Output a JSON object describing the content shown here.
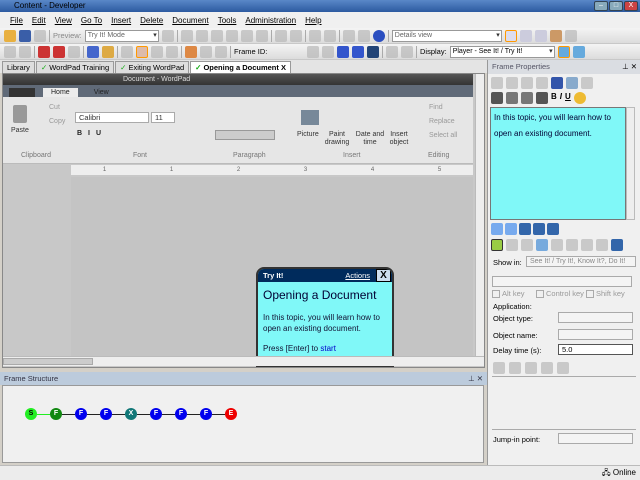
{
  "window": {
    "title": "Content - Developer",
    "min": "–",
    "max": "□",
    "close": "X"
  },
  "menu": [
    "File",
    "Edit",
    "View",
    "Go To",
    "Insert",
    "Delete",
    "Document",
    "Tools",
    "Administration",
    "Help"
  ],
  "toolbar1": {
    "preview_label": "Preview:",
    "preview_mode": "Try It! Mode",
    "view_select": "Details view"
  },
  "toolbar2": {
    "frame_id_label": "Frame ID:",
    "display_label": "Display:",
    "display_select": "Player - See It! / Try It!"
  },
  "tabs": [
    {
      "label": "Library"
    },
    {
      "label": "WordPad Training"
    },
    {
      "label": "Exiting WordPad"
    },
    {
      "label": "Opening a Document",
      "close": "X"
    }
  ],
  "wordpad": {
    "title": "Document - WordPad",
    "tabs": [
      "Home",
      "View"
    ],
    "clipboard": {
      "paste": "Paste",
      "cut": "Cut",
      "copy": "Copy",
      "group": "Clipboard"
    },
    "font": {
      "name": "Calibri",
      "size": "11",
      "group": "Font"
    },
    "paragraph": {
      "group": "Paragraph"
    },
    "insert": {
      "picture": "Picture",
      "paint": "Paint drawing",
      "datetime": "Date and time",
      "object": "Insert object",
      "group": "Insert"
    },
    "editing": {
      "find": "Find",
      "replace": "Replace",
      "select_all": "Select all",
      "group": "Editing"
    },
    "ruler": [
      "1",
      "1",
      "2",
      "3",
      "4",
      "5"
    ]
  },
  "bubble": {
    "header": "Try It!",
    "actions": "Actions",
    "close": "X",
    "title": "Opening a Document",
    "text": "In this topic, you will learn how to open an existing document.",
    "press": "Press [Enter] to ",
    "start": "start"
  },
  "frame_structure": {
    "title": "Frame Structure",
    "nodes": [
      {
        "l": "S",
        "c": "#22ee22"
      },
      {
        "l": "F",
        "c": "#118811"
      },
      {
        "l": "F",
        "c": "#0000ee"
      },
      {
        "l": "F",
        "c": "#0000ee"
      },
      {
        "l": "X",
        "c": "#117777"
      },
      {
        "l": "F",
        "c": "#0000ee"
      },
      {
        "l": "F",
        "c": "#0000ee"
      },
      {
        "l": "F",
        "c": "#0000ee"
      },
      {
        "l": "E",
        "c": "#ee0000"
      }
    ]
  },
  "frame_properties": {
    "title": "Frame Properties",
    "text": "In this topic, you will learn how to open an existing document.",
    "show_in_label": "Show in:",
    "show_in": "See It! / Try It!, Know It?, Do It!",
    "alt": "Alt key",
    "ctrl": "Control key",
    "shift": "Shift key",
    "application": "Application:",
    "object_type": "Object type:",
    "object_name": "Object name:",
    "delay_label": "Delay time (s):",
    "delay": "5.0",
    "jump_in": "Jump-in point:"
  },
  "status": {
    "text": "Online"
  }
}
